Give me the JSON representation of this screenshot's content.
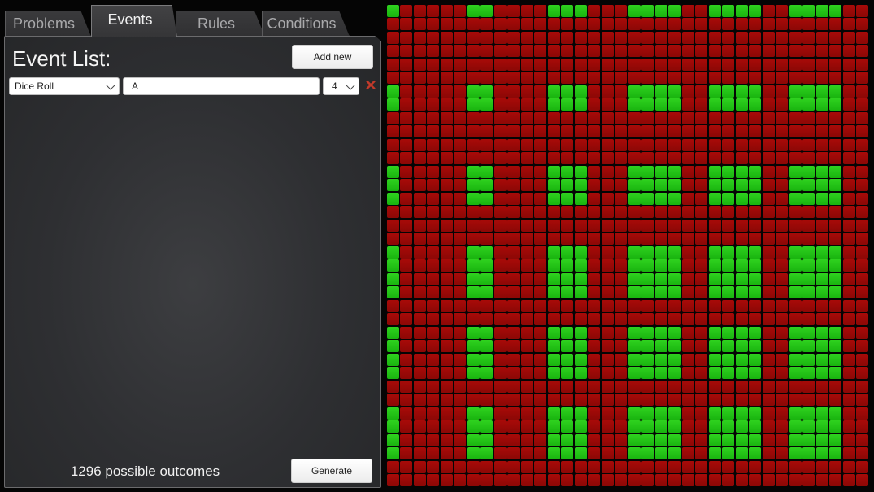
{
  "tabs": {
    "problems": "Problems",
    "events": "Events",
    "rules": "Rules",
    "conditions": "Conditions",
    "active": "events"
  },
  "panel": {
    "title": "Event List:",
    "add_new_label": "Add new",
    "generate_label": "Generate",
    "outcomes_text": "1296 possible outcomes"
  },
  "events": [
    {
      "type": "Dice Roll",
      "name": "A",
      "count": "4",
      "remove_icon": "close-x-icon"
    }
  ],
  "outcome_grid": {
    "rows": 36,
    "columns": 36,
    "pattern": "cell is green when both row index and column index (0-based) are divisible-by-6 group offsets 0-3",
    "colors": {
      "match": "#22c414",
      "no_match": "#9a0907"
    }
  }
}
